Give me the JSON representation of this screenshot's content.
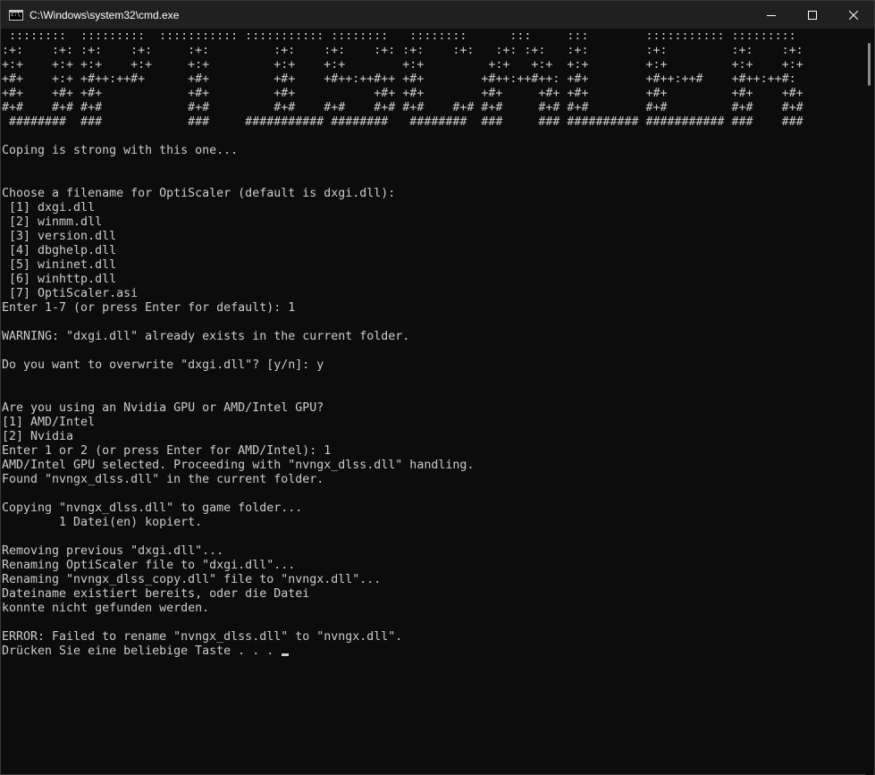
{
  "window": {
    "title": "C:\\Windows\\system32\\cmd.exe",
    "icon": "cmd-icon"
  },
  "controls": {
    "minimize_icon": "minimize-icon",
    "maximize_icon": "maximize-icon",
    "close_icon": "close-icon"
  },
  "console": {
    "lines": [
      " ::::::::  :::::::::  ::::::::::: ::::::::::: ::::::::   ::::::::      :::     :::        ::::::::::: :::::::::",
      ":+:    :+: :+:    :+:     :+:         :+:    :+:    :+: :+:    :+:   :+: :+:   :+:        :+:         :+:    :+:",
      "+:+    +:+ +:+    +:+     +:+         +:+    +:+        +:+         +:+   +:+  +:+        +:+         +:+    +:+",
      "+#+    +:+ +#++:++#+      +#+         +#+    +#++:++#++ +#+        +#++:++#++: +#+        +#++:++#    +#++:++#:",
      "+#+    +#+ +#+            +#+         +#+           +#+ +#+        +#+     +#+ +#+        +#+         +#+    +#+",
      "#+#    #+# #+#            #+#         #+#    #+#    #+# #+#    #+# #+#     #+# #+#        #+#         #+#    #+#",
      " ########  ###            ###     ########### ########   ########  ###     ### ########## ########### ###    ###",
      "",
      "Coping is strong with this one...",
      "",
      "",
      "Choose a filename for OptiScaler (default is dxgi.dll):",
      " [1] dxgi.dll",
      " [2] winmm.dll",
      " [3] version.dll",
      " [4] dbghelp.dll",
      " [5] wininet.dll",
      " [6] winhttp.dll",
      " [7] OptiScaler.asi",
      "Enter 1-7 (or press Enter for default): 1",
      "",
      "WARNING: \"dxgi.dll\" already exists in the current folder.",
      "",
      "Do you want to overwrite \"dxgi.dll\"? [y/n]: y",
      "",
      "",
      "Are you using an Nvidia GPU or AMD/Intel GPU?",
      "[1] AMD/Intel",
      "[2] Nvidia",
      "Enter 1 or 2 (or press Enter for AMD/Intel): 1",
      "AMD/Intel GPU selected. Proceeding with \"nvngx_dlss.dll\" handling.",
      "Found \"nvngx_dlss.dll\" in the current folder.",
      "",
      "Copying \"nvngx_dlss.dll\" to game folder...",
      "        1 Datei(en) kopiert.",
      "",
      "Removing previous \"dxgi.dll\"...",
      "Renaming OptiScaler file to \"dxgi.dll\"...",
      "Renaming \"nvngx_dlss_copy.dll\" file to \"nvngx.dll\"...",
      "Dateiname existiert bereits, oder die Datei",
      "konnte nicht gefunden werden.",
      "",
      "ERROR: Failed to rename \"nvngx_dlss.dll\" to \"nvngx.dll\".",
      "Drücken Sie eine beliebige Taste . . . "
    ]
  }
}
